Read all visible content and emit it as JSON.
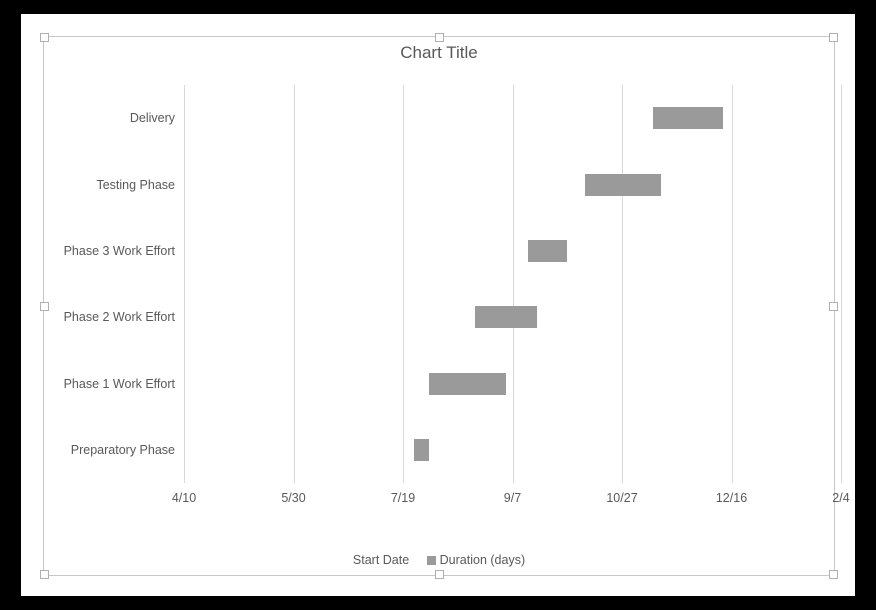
{
  "title": "Chart Title",
  "legend": {
    "series1": "Start Date",
    "series2": "Duration (days)"
  },
  "x_ticks": [
    "4/10",
    "5/30",
    "7/19",
    "9/7",
    "10/27",
    "12/16",
    "2/4"
  ],
  "categories": [
    "Preparatory Phase",
    "Phase 1 Work Effort",
    "Phase 2 Work Effort",
    "Phase 3 Work Effort",
    "Testing Phase",
    "Delivery"
  ],
  "chart_data": {
    "type": "bar",
    "orientation": "horizontal-stacked-gantt",
    "title": "Chart Title",
    "xlabel": "",
    "ylabel": "",
    "x_axis": {
      "type": "date",
      "min": "4/10",
      "max": "2/4",
      "ticks": [
        "4/10",
        "5/30",
        "7/19",
        "9/7",
        "10/27",
        "12/16",
        "2/4"
      ]
    },
    "categories": [
      "Preparatory Phase",
      "Phase 1 Work Effort",
      "Phase 2 Work Effort",
      "Phase 3 Work Effort",
      "Testing Phase",
      "Delivery"
    ],
    "series": [
      {
        "name": "Start Date",
        "values": [
          "7/24",
          "7/31",
          "8/21",
          "9/14",
          "10/10",
          "11/10"
        ],
        "role": "offset-invisible"
      },
      {
        "name": "Duration (days)",
        "values": [
          7,
          35,
          28,
          18,
          35,
          32
        ],
        "role": "visible-bar"
      }
    ],
    "ylim": null,
    "legend_position": "bottom"
  }
}
